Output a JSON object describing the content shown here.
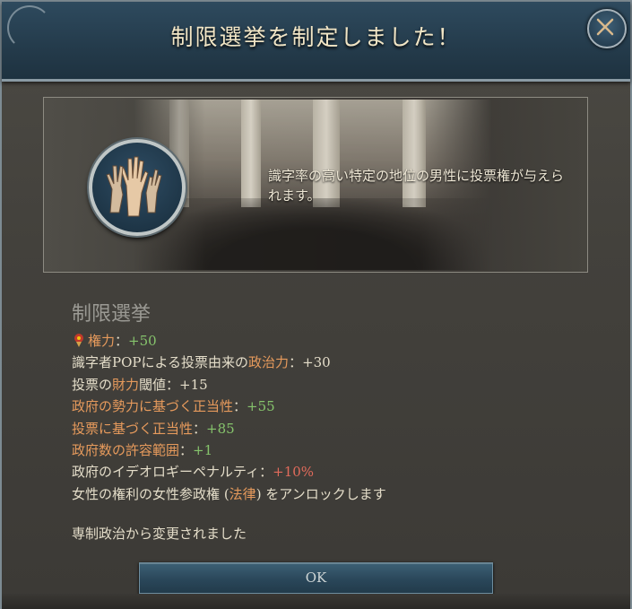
{
  "dialog": {
    "title": "制限選挙を制定しました！",
    "close_icon": "close-icon",
    "description": "識字率の高い特定の地位の男性に投票権が与えられます。",
    "emblem_icon": "raised-hands-icon",
    "law_name": "制限選挙",
    "effects": [
      {
        "parts": [
          {
            "t": "権力",
            "c": "orange"
          },
          {
            "t": "：",
            "c": "white"
          },
          {
            "t": "+50",
            "c": "green"
          }
        ],
        "icon": "power-icon"
      },
      {
        "parts": [
          {
            "t": "識字者POPによる投票由来の",
            "c": "white"
          },
          {
            "t": "政治力",
            "c": "orange"
          },
          {
            "t": "：+30",
            "c": "white"
          }
        ]
      },
      {
        "parts": [
          {
            "t": "投票の",
            "c": "white"
          },
          {
            "t": "財力",
            "c": "orange"
          },
          {
            "t": "閾値：+15",
            "c": "white"
          }
        ]
      },
      {
        "parts": [
          {
            "t": "政府の勢力に基づく",
            "c": "orange"
          },
          {
            "t": "正当性",
            "c": "orange"
          },
          {
            "t": "：",
            "c": "white"
          },
          {
            "t": "+55",
            "c": "green"
          }
        ]
      },
      {
        "parts": [
          {
            "t": "投票に基づく",
            "c": "orange"
          },
          {
            "t": "正当性",
            "c": "orange"
          },
          {
            "t": "：",
            "c": "white"
          },
          {
            "t": "+85",
            "c": "green"
          }
        ]
      },
      {
        "parts": [
          {
            "t": "政府数の許容範囲",
            "c": "orange"
          },
          {
            "t": "：",
            "c": "white"
          },
          {
            "t": "+1",
            "c": "green"
          }
        ]
      },
      {
        "parts": [
          {
            "t": "政府のイデオロギーペナルティ",
            "c": "white"
          },
          {
            "t": "：",
            "c": "white"
          },
          {
            "t": "+10%",
            "c": "red"
          }
        ]
      },
      {
        "parts": [
          {
            "t": "女性の権利",
            "c": "white"
          },
          {
            "t": "の",
            "c": "white"
          },
          {
            "t": "女性参政権",
            "c": "white"
          },
          {
            "t": " (",
            "c": "white"
          },
          {
            "t": "法律",
            "c": "orange"
          },
          {
            "t": ") をアンロックします",
            "c": "white"
          }
        ]
      }
    ],
    "changed_text": "専制政治から変更されました",
    "ok_label": "OK"
  }
}
